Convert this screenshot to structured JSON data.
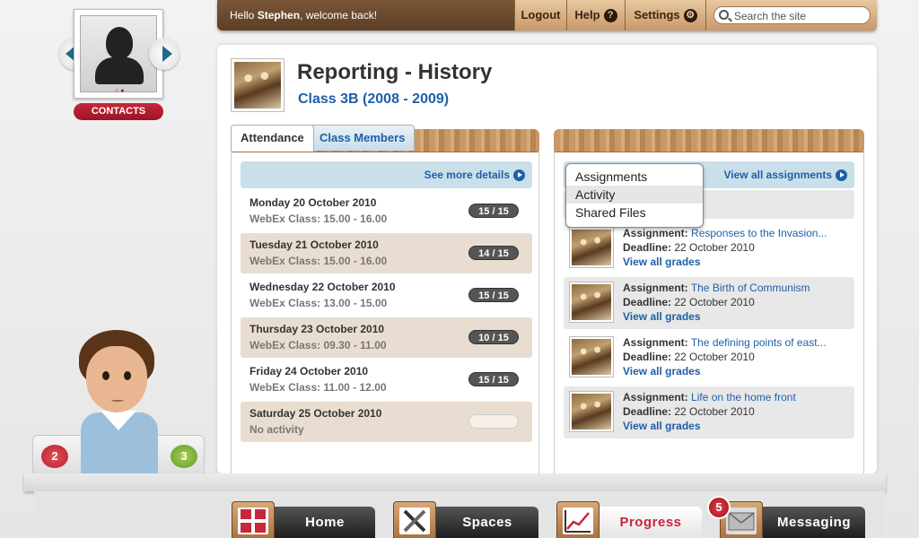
{
  "header": {
    "greeting_prefix": "Hello ",
    "user_name": "Stephen",
    "greeting_suffix": ", welcome back!",
    "logout": "Logout",
    "help": "Help",
    "settings": "Settings",
    "search_placeholder": "Search the site"
  },
  "contacts": {
    "label": "CONTACTS"
  },
  "avatar": {
    "badge_red": "2",
    "badge_green": "3"
  },
  "page": {
    "title": "Reporting - History",
    "subtitle": "Class 3B (2008 - 2009)"
  },
  "tabs": [
    {
      "label": "Attendance",
      "active": true
    },
    {
      "label": "Class Members",
      "active": false
    }
  ],
  "attendance": {
    "see_more": "See more details",
    "rows": [
      {
        "date": "Monday 20 October 2010",
        "detail": "WebEx Class: 15.00 - 16.00",
        "score": "15 / 15"
      },
      {
        "date": "Tuesday 21 October 2010",
        "detail": "WebEx Class: 15.00 - 16.00",
        "score": "14 / 15"
      },
      {
        "date": "Wednesday 22 October 2010",
        "detail": "WebEx Class: 13.00 - 15.00",
        "score": "15 / 15"
      },
      {
        "date": "Thursday 23 October 2010",
        "detail": "WebEx Class: 09.30 - 11.00",
        "score": "10 / 15"
      },
      {
        "date": "Friday 24 October 2010",
        "detail": "WebEx Class: 11.00 - 12.00",
        "score": "15 / 15"
      },
      {
        "date": "Saturday 25 October 2010",
        "detail": "No activity",
        "score": ""
      }
    ]
  },
  "assignments": {
    "view_all": "View all assignments",
    "dropdown": [
      "Assignments",
      "Activity",
      "Shared Files"
    ],
    "dropdown_highlighted": "Activity",
    "label_assignment": "Assignment:",
    "label_deadline": "Deadline:",
    "view_grades": "View all grades",
    "rows": [
      {
        "title": "Responses to the Invasion...",
        "deadline": "22 October 2010"
      },
      {
        "title": "The Birth of Communism",
        "deadline": "22 October 2010"
      },
      {
        "title": "The defining points of east...",
        "deadline": "22 October 2010"
      },
      {
        "title": "Life on the home front",
        "deadline": "22 October 2010"
      }
    ]
  },
  "nav": {
    "items": [
      {
        "label": "Home",
        "icon": "grid-icon"
      },
      {
        "label": "Spaces",
        "icon": "tools-icon"
      },
      {
        "label": "Progress",
        "icon": "chart-icon",
        "active": true
      },
      {
        "label": "Messaging",
        "icon": "envelope-icon"
      }
    ],
    "messaging_badge": "5"
  },
  "colors": {
    "accent_blue": "#1f5fa8",
    "brand_red": "#c8263a",
    "wood": "#c89868"
  }
}
